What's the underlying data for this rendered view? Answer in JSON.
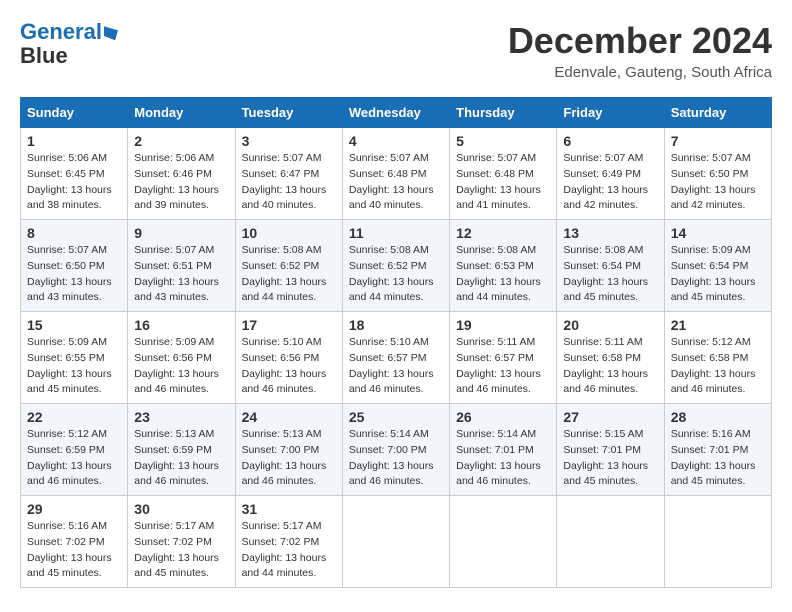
{
  "logo": {
    "line1": "General",
    "line2": "Blue"
  },
  "title": "December 2024",
  "location": "Edenvale, Gauteng, South Africa",
  "headers": [
    "Sunday",
    "Monday",
    "Tuesday",
    "Wednesday",
    "Thursday",
    "Friday",
    "Saturday"
  ],
  "weeks": [
    [
      {
        "day": "1",
        "sunrise": "5:06 AM",
        "sunset": "6:45 PM",
        "daylight": "13 hours and 38 minutes."
      },
      {
        "day": "2",
        "sunrise": "5:06 AM",
        "sunset": "6:46 PM",
        "daylight": "13 hours and 39 minutes."
      },
      {
        "day": "3",
        "sunrise": "5:07 AM",
        "sunset": "6:47 PM",
        "daylight": "13 hours and 40 minutes."
      },
      {
        "day": "4",
        "sunrise": "5:07 AM",
        "sunset": "6:48 PM",
        "daylight": "13 hours and 40 minutes."
      },
      {
        "day": "5",
        "sunrise": "5:07 AM",
        "sunset": "6:48 PM",
        "daylight": "13 hours and 41 minutes."
      },
      {
        "day": "6",
        "sunrise": "5:07 AM",
        "sunset": "6:49 PM",
        "daylight": "13 hours and 42 minutes."
      },
      {
        "day": "7",
        "sunrise": "5:07 AM",
        "sunset": "6:50 PM",
        "daylight": "13 hours and 42 minutes."
      }
    ],
    [
      {
        "day": "8",
        "sunrise": "5:07 AM",
        "sunset": "6:50 PM",
        "daylight": "13 hours and 43 minutes."
      },
      {
        "day": "9",
        "sunrise": "5:07 AM",
        "sunset": "6:51 PM",
        "daylight": "13 hours and 43 minutes."
      },
      {
        "day": "10",
        "sunrise": "5:08 AM",
        "sunset": "6:52 PM",
        "daylight": "13 hours and 44 minutes."
      },
      {
        "day": "11",
        "sunrise": "5:08 AM",
        "sunset": "6:52 PM",
        "daylight": "13 hours and 44 minutes."
      },
      {
        "day": "12",
        "sunrise": "5:08 AM",
        "sunset": "6:53 PM",
        "daylight": "13 hours and 44 minutes."
      },
      {
        "day": "13",
        "sunrise": "5:08 AM",
        "sunset": "6:54 PM",
        "daylight": "13 hours and 45 minutes."
      },
      {
        "day": "14",
        "sunrise": "5:09 AM",
        "sunset": "6:54 PM",
        "daylight": "13 hours and 45 minutes."
      }
    ],
    [
      {
        "day": "15",
        "sunrise": "5:09 AM",
        "sunset": "6:55 PM",
        "daylight": "13 hours and 45 minutes."
      },
      {
        "day": "16",
        "sunrise": "5:09 AM",
        "sunset": "6:56 PM",
        "daylight": "13 hours and 46 minutes."
      },
      {
        "day": "17",
        "sunrise": "5:10 AM",
        "sunset": "6:56 PM",
        "daylight": "13 hours and 46 minutes."
      },
      {
        "day": "18",
        "sunrise": "5:10 AM",
        "sunset": "6:57 PM",
        "daylight": "13 hours and 46 minutes."
      },
      {
        "day": "19",
        "sunrise": "5:11 AM",
        "sunset": "6:57 PM",
        "daylight": "13 hours and 46 minutes."
      },
      {
        "day": "20",
        "sunrise": "5:11 AM",
        "sunset": "6:58 PM",
        "daylight": "13 hours and 46 minutes."
      },
      {
        "day": "21",
        "sunrise": "5:12 AM",
        "sunset": "6:58 PM",
        "daylight": "13 hours and 46 minutes."
      }
    ],
    [
      {
        "day": "22",
        "sunrise": "5:12 AM",
        "sunset": "6:59 PM",
        "daylight": "13 hours and 46 minutes."
      },
      {
        "day": "23",
        "sunrise": "5:13 AM",
        "sunset": "6:59 PM",
        "daylight": "13 hours and 46 minutes."
      },
      {
        "day": "24",
        "sunrise": "5:13 AM",
        "sunset": "7:00 PM",
        "daylight": "13 hours and 46 minutes."
      },
      {
        "day": "25",
        "sunrise": "5:14 AM",
        "sunset": "7:00 PM",
        "daylight": "13 hours and 46 minutes."
      },
      {
        "day": "26",
        "sunrise": "5:14 AM",
        "sunset": "7:01 PM",
        "daylight": "13 hours and 46 minutes."
      },
      {
        "day": "27",
        "sunrise": "5:15 AM",
        "sunset": "7:01 PM",
        "daylight": "13 hours and 45 minutes."
      },
      {
        "day": "28",
        "sunrise": "5:16 AM",
        "sunset": "7:01 PM",
        "daylight": "13 hours and 45 minutes."
      }
    ],
    [
      {
        "day": "29",
        "sunrise": "5:16 AM",
        "sunset": "7:02 PM",
        "daylight": "13 hours and 45 minutes."
      },
      {
        "day": "30",
        "sunrise": "5:17 AM",
        "sunset": "7:02 PM",
        "daylight": "13 hours and 45 minutes."
      },
      {
        "day": "31",
        "sunrise": "5:17 AM",
        "sunset": "7:02 PM",
        "daylight": "13 hours and 44 minutes."
      },
      null,
      null,
      null,
      null
    ]
  ],
  "labels": {
    "sunrise": "Sunrise:",
    "sunset": "Sunset:",
    "daylight": "Daylight:"
  }
}
